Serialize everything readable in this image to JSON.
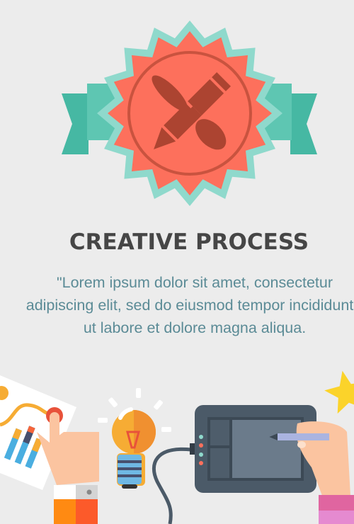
{
  "title": "CREATIVE PROCESS",
  "quote_lines": [
    "\"Lorem ipsum dolor sit amet, consectetur",
    "adipiscing elit, sed do eiusmod tempor incididunt",
    "ut labore et dolore magna aliqua."
  ],
  "colors": {
    "background": "#ececec",
    "ribbon": "#46b8a3",
    "ribbon_light": "#5ec6b2",
    "badge_outer": "#8fd9cc",
    "badge": "#fd705c",
    "badge_icon": "#ac4431",
    "tablet": "#4b5a68",
    "bulb": "#f6ac34"
  },
  "icons": [
    "badge-pencil-brush-icon",
    "chart-paper-icon",
    "pointing-hand-icon",
    "lightbulb-icon",
    "drawing-tablet-icon",
    "stylus-hand-icon",
    "star-icon"
  ]
}
